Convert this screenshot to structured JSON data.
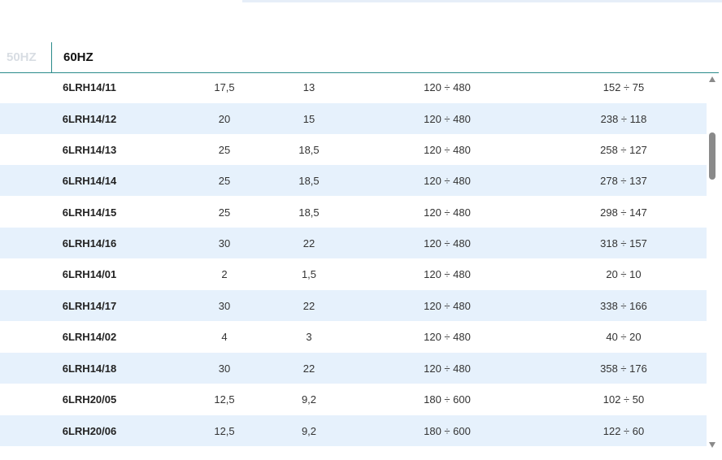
{
  "tabs": {
    "hz50": "50HZ",
    "hz60": "60HZ",
    "active": "60HZ"
  },
  "colors": {
    "accent": "#2a8a8a",
    "row_alt": "#e6f1fc",
    "inactive_tab": "#d8dde3"
  },
  "rows": [
    {
      "model": "6LRH14/11",
      "kw": "17,5",
      "hp": "13",
      "flow": "120 ÷ 480",
      "head": "152 ÷ 75"
    },
    {
      "model": "6LRH14/12",
      "kw": "20",
      "hp": "15",
      "flow": "120 ÷ 480",
      "head": "238 ÷ 118"
    },
    {
      "model": "6LRH14/13",
      "kw": "25",
      "hp": "18,5",
      "flow": "120 ÷ 480",
      "head": "258 ÷ 127"
    },
    {
      "model": "6LRH14/14",
      "kw": "25",
      "hp": "18,5",
      "flow": "120 ÷ 480",
      "head": "278 ÷ 137"
    },
    {
      "model": "6LRH14/15",
      "kw": "25",
      "hp": "18,5",
      "flow": "120 ÷ 480",
      "head": "298 ÷ 147"
    },
    {
      "model": "6LRH14/16",
      "kw": "30",
      "hp": "22",
      "flow": "120 ÷ 480",
      "head": "318 ÷ 157"
    },
    {
      "model": "6LRH14/01",
      "kw": "2",
      "hp": "1,5",
      "flow": "120 ÷ 480",
      "head": "20 ÷ 10"
    },
    {
      "model": "6LRH14/17",
      "kw": "30",
      "hp": "22",
      "flow": "120 ÷ 480",
      "head": "338 ÷ 166"
    },
    {
      "model": "6LRH14/02",
      "kw": "4",
      "hp": "3",
      "flow": "120 ÷ 480",
      "head": "40 ÷ 20"
    },
    {
      "model": "6LRH14/18",
      "kw": "30",
      "hp": "22",
      "flow": "120 ÷ 480",
      "head": "358 ÷ 176"
    },
    {
      "model": "6LRH20/05",
      "kw": "12,5",
      "hp": "9,2",
      "flow": "180 ÷ 600",
      "head": "102 ÷ 50"
    },
    {
      "model": "6LRH20/06",
      "kw": "12,5",
      "hp": "9,2",
      "flow": "180 ÷ 600",
      "head": "122 ÷ 60"
    }
  ]
}
